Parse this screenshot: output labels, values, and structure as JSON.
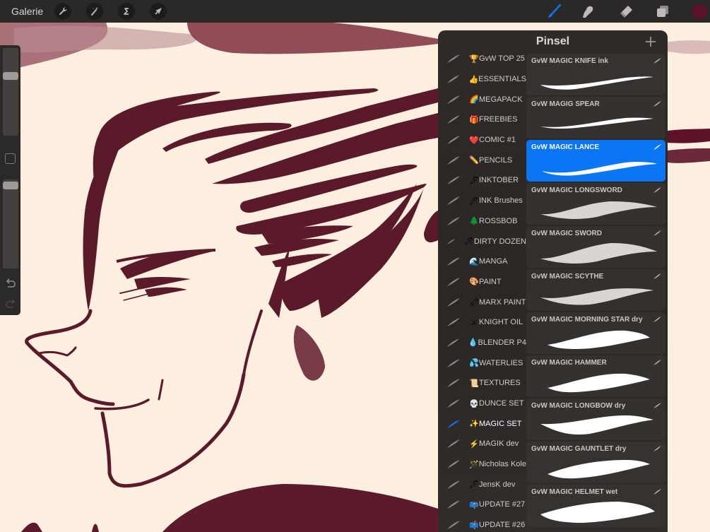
{
  "topbar": {
    "gallery_label": "Galerie",
    "left_tools": [
      {
        "name": "actions",
        "icon": "wrench-icon"
      },
      {
        "name": "adjustments",
        "icon": "magic-wand-icon"
      },
      {
        "name": "selection",
        "icon": "selection-s-icon"
      },
      {
        "name": "transform",
        "icon": "arrow-cursor-icon"
      }
    ],
    "right_tools": [
      {
        "name": "brush",
        "icon": "brush-icon",
        "active": true
      },
      {
        "name": "smudge",
        "icon": "smudge-finger-icon"
      },
      {
        "name": "eraser",
        "icon": "eraser-icon"
      },
      {
        "name": "layers",
        "icon": "layers-icon"
      }
    ],
    "current_color": "#5c1327",
    "accent_color": "#0a76f6"
  },
  "sidebar": {
    "brush_size_level": 0.7,
    "opacity_level": 0.03,
    "undo_icon": "undo-icon",
    "redo_icon": "redo-icon"
  },
  "panel": {
    "title": "Pinsel",
    "add_icon": "plus-icon",
    "brush_sets": [
      {
        "emoji": "🏆",
        "label": "GvW TOP 25"
      },
      {
        "emoji": "👍",
        "label": "ESSENTIALS"
      },
      {
        "emoji": "🌈",
        "label": "MEGAPACK"
      },
      {
        "emoji": "🎁",
        "label": "FREEBIES"
      },
      {
        "emoji": "❤️",
        "label": "COMIC #1"
      },
      {
        "emoji": "✏️",
        "label": "PENCILS"
      },
      {
        "emoji": "🖊",
        "label": "INKTOBER"
      },
      {
        "emoji": "🖋",
        "label": "INK Brushes"
      },
      {
        "emoji": "🌲",
        "label": "ROSSBOB"
      },
      {
        "emoji": "🖊",
        "label": "DIRTY DOZEN"
      },
      {
        "emoji": "🌊",
        "label": "MANGA"
      },
      {
        "emoji": "🎨",
        "label": "PAINT"
      },
      {
        "emoji": "🖍",
        "label": "MARX PAINT"
      },
      {
        "emoji": "⚔",
        "label": "KNIGHT OIL"
      },
      {
        "emoji": "💧",
        "label": "BLENDER P4"
      },
      {
        "emoji": "💦",
        "label": "WATERLIES"
      },
      {
        "emoji": "📜",
        "label": "TEXTURES"
      },
      {
        "emoji": "💀",
        "label": "DUNCE SET"
      },
      {
        "emoji": "✨",
        "label": "MAGIC SET",
        "active": true
      },
      {
        "emoji": "⚡",
        "label": "MAGIK dev"
      },
      {
        "emoji": "🪄",
        "label": "Nicholas Kole"
      },
      {
        "emoji": "🖊",
        "label": "JensK dev"
      },
      {
        "emoji": "📪",
        "label": "UPDATE #27"
      },
      {
        "emoji": "📫",
        "label": "UPDATE #26"
      }
    ],
    "brushes": [
      {
        "label": "GvW MAGIC KNIFE ink"
      },
      {
        "label": "GvW MAGIG SPEAR"
      },
      {
        "label": "GvW MAGIC LANCE",
        "active": true
      },
      {
        "label": "GvW MAGIC LONGSWORD"
      },
      {
        "label": "GvW MAGIC SWORD"
      },
      {
        "label": "GvW MAGIC SCYTHE"
      },
      {
        "label": "GvW MAGIC MORNING STAR dry"
      },
      {
        "label": "GvW MAGIC HAMMER"
      },
      {
        "label": "GvW MAGIC LONGBOW dry"
      },
      {
        "label": "GvW MAGIC GAUNTLET dry"
      },
      {
        "label": "GvW MAGIC HELMET wet"
      }
    ]
  }
}
